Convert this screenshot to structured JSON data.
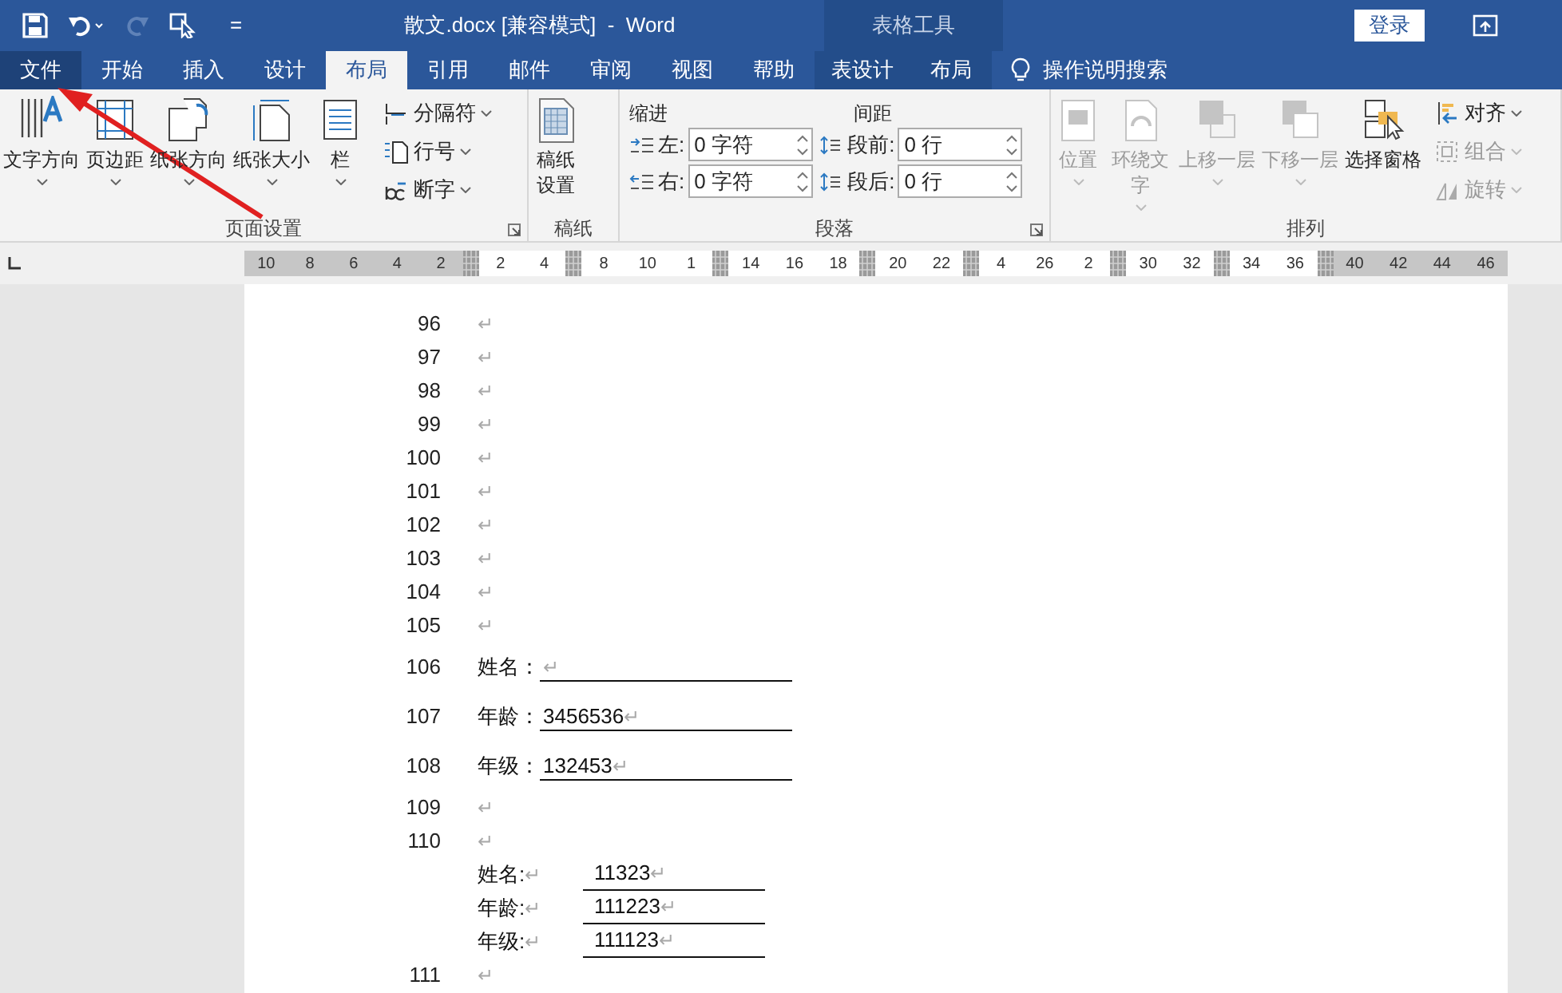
{
  "window": {
    "title": "散文.docx [兼容模式]  -  Word",
    "context_header": "表格工具",
    "login": "登录",
    "qat_more": "="
  },
  "tabs": [
    {
      "label": "文件",
      "kind": "file",
      "selected": false
    },
    {
      "label": "开始",
      "kind": "normal",
      "selected": false
    },
    {
      "label": "插入",
      "kind": "normal",
      "selected": false
    },
    {
      "label": "设计",
      "kind": "normal",
      "selected": false
    },
    {
      "label": "布局",
      "kind": "normal",
      "selected": true
    },
    {
      "label": "引用",
      "kind": "normal",
      "selected": false
    },
    {
      "label": "邮件",
      "kind": "normal",
      "selected": false
    },
    {
      "label": "审阅",
      "kind": "normal",
      "selected": false
    },
    {
      "label": "视图",
      "kind": "normal",
      "selected": false
    },
    {
      "label": "帮助",
      "kind": "normal",
      "selected": false
    },
    {
      "label": "表设计",
      "kind": "contextual",
      "selected": false
    },
    {
      "label": "布局",
      "kind": "contextual",
      "selected": false
    }
  ],
  "tell_me": "操作说明搜索",
  "ribbon": {
    "groups": [
      {
        "kind": "buttons",
        "label": "页面设置",
        "launcher": true,
        "large": [
          {
            "label": "文字方向",
            "dropdown": true,
            "disabled": false
          },
          {
            "label": "页边距",
            "dropdown": true,
            "disabled": false
          },
          {
            "label": "纸张方向",
            "dropdown": true,
            "disabled": false
          },
          {
            "label": "纸张大小",
            "dropdown": true,
            "disabled": false
          },
          {
            "label": "栏",
            "dropdown": true,
            "disabled": false
          }
        ],
        "small": [
          {
            "label": "分隔符",
            "dropdown": true,
            "disabled": false
          },
          {
            "label": "行号",
            "dropdown": true,
            "disabled": false
          },
          {
            "label": "断字",
            "dropdown": true,
            "disabled": false
          }
        ]
      },
      {
        "kind": "buttons",
        "label": "稿纸",
        "large": [
          {
            "label": "稿纸设置",
            "dropdown": false,
            "disabled": false
          }
        ]
      },
      {
        "kind": "spinners",
        "label": "段落",
        "launcher": true,
        "columns": [
          {
            "heading": "缩进",
            "fields": [
              {
                "label": "左:",
                "value": "0 字符"
              },
              {
                "label": "右:",
                "value": "0 字符"
              }
            ]
          },
          {
            "heading": "间距",
            "fields": [
              {
                "label": "段前:",
                "value": "0 行"
              },
              {
                "label": "段后:",
                "value": "0 行"
              }
            ]
          }
        ]
      },
      {
        "kind": "buttons",
        "label": "排列",
        "large": [
          {
            "label": "位置",
            "dropdown": true,
            "disabled": true
          },
          {
            "label": "环绕文字",
            "dropdown": true,
            "disabled": true
          },
          {
            "label": "上移一层",
            "dropdown": true,
            "disabled": true
          },
          {
            "label": "下移一层",
            "dropdown": true,
            "disabled": true
          },
          {
            "label": "选择窗格",
            "dropdown": false,
            "disabled": false
          }
        ],
        "small": [
          {
            "label": "对齐",
            "dropdown": true,
            "disabled": false
          },
          {
            "label": "组合",
            "dropdown": true,
            "disabled": true
          },
          {
            "label": "旋转",
            "dropdown": true,
            "disabled": true
          }
        ]
      }
    ]
  },
  "ruler": [
    {
      "kind": "num",
      "text": "10",
      "shaded": true
    },
    {
      "kind": "num",
      "text": "8",
      "shaded": true
    },
    {
      "kind": "num",
      "text": "6",
      "shaded": true
    },
    {
      "kind": "num",
      "text": "4",
      "shaded": true
    },
    {
      "kind": "num",
      "text": "2",
      "shaded": true
    },
    {
      "kind": "marker"
    },
    {
      "kind": "num",
      "text": "2",
      "shaded": false
    },
    {
      "kind": "num",
      "text": "4",
      "shaded": false
    },
    {
      "kind": "marker"
    },
    {
      "kind": "num",
      "text": "8",
      "shaded": false
    },
    {
      "kind": "num",
      "text": "10",
      "shaded": false
    },
    {
      "kind": "num",
      "text": "1",
      "shaded": false
    },
    {
      "kind": "marker"
    },
    {
      "kind": "num",
      "text": "14",
      "shaded": false
    },
    {
      "kind": "num",
      "text": "16",
      "shaded": false
    },
    {
      "kind": "num",
      "text": "18",
      "shaded": false
    },
    {
      "kind": "marker"
    },
    {
      "kind": "num",
      "text": "20",
      "shaded": false
    },
    {
      "kind": "num",
      "text": "22",
      "shaded": false
    },
    {
      "kind": "marker"
    },
    {
      "kind": "num",
      "text": "4",
      "shaded": false
    },
    {
      "kind": "num",
      "text": "26",
      "shaded": false
    },
    {
      "kind": "num",
      "text": "2",
      "shaded": false
    },
    {
      "kind": "marker"
    },
    {
      "kind": "num",
      "text": "30",
      "shaded": false
    },
    {
      "kind": "num",
      "text": "32",
      "shaded": false
    },
    {
      "kind": "marker"
    },
    {
      "kind": "num",
      "text": "34",
      "shaded": false
    },
    {
      "kind": "num",
      "text": "36",
      "shaded": false
    },
    {
      "kind": "marker"
    },
    {
      "kind": "num",
      "text": "40",
      "shaded": true
    },
    {
      "kind": "num",
      "text": "42",
      "shaded": true
    },
    {
      "kind": "num",
      "text": "44",
      "shaded": true
    },
    {
      "kind": "num",
      "text": "46",
      "shaded": true
    }
  ],
  "document": {
    "lines": [
      {
        "kind": "empty",
        "number": "96",
        "mark": "↵"
      },
      {
        "kind": "empty",
        "number": "97",
        "mark": "↵"
      },
      {
        "kind": "empty",
        "number": "98",
        "mark": "↵"
      },
      {
        "kind": "empty",
        "number": "99",
        "mark": "↵"
      },
      {
        "kind": "empty",
        "number": "100",
        "mark": "↵"
      },
      {
        "kind": "empty",
        "number": "101",
        "mark": "↵"
      },
      {
        "kind": "empty",
        "number": "102",
        "mark": "↵"
      },
      {
        "kind": "empty",
        "number": "103",
        "mark": "↵"
      },
      {
        "kind": "empty",
        "number": "104",
        "mark": "↵"
      },
      {
        "kind": "empty",
        "number": "105",
        "mark": "↵"
      },
      {
        "kind": "field",
        "number": "106",
        "label": "姓名：",
        "mark": "↵"
      },
      {
        "kind": "field",
        "number": "107",
        "label": "年龄：",
        "value": "3456536",
        "mark": "↵"
      },
      {
        "kind": "field",
        "number": "108",
        "label": "年级：",
        "value": "132453",
        "mark": "↵"
      },
      {
        "kind": "empty",
        "number": "109",
        "mark": "↵"
      },
      {
        "kind": "empty",
        "number": "110",
        "mark": "↵"
      },
      {
        "kind": "table",
        "rows": [
          {
            "label": "姓名:",
            "label_mark": "↵",
            "value": "11323",
            "value_mark": "↵"
          },
          {
            "label": "年龄:",
            "label_mark": "↵",
            "value": "111223",
            "value_mark": "↵"
          },
          {
            "label": "年级:",
            "label_mark": "↵",
            "value": "111123",
            "value_mark": "↵"
          }
        ]
      },
      {
        "kind": "empty",
        "number": "111",
        "mark": "↵"
      }
    ]
  }
}
